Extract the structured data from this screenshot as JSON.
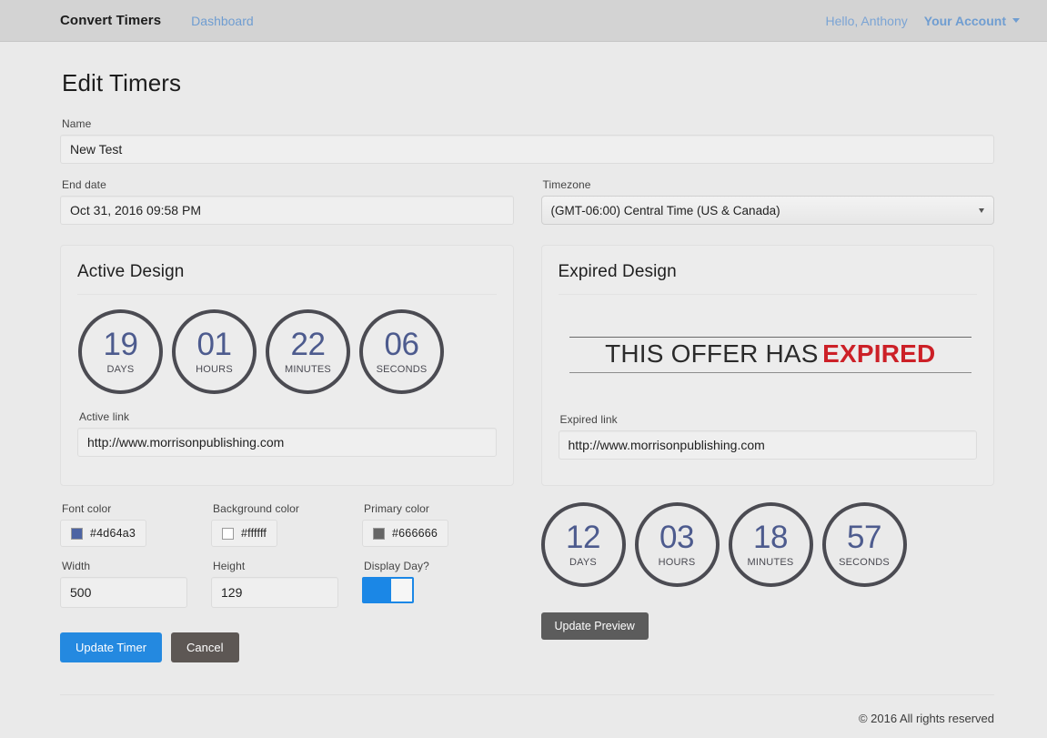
{
  "navbar": {
    "brand": "Convert Timers",
    "dashboard_label": "Dashboard",
    "greeting": "Hello, Anthony",
    "account_label": "Your Account"
  },
  "page": {
    "title": "Edit Timers"
  },
  "form": {
    "name_label": "Name",
    "name_value": "New Test",
    "name_placeholder": "Name",
    "end_date_label": "End date",
    "end_date_value": "Oct 31, 2016 09:58 PM",
    "end_date_placeholder": "End date",
    "timezone_label": "Timezone",
    "timezone_value": "(GMT-06:00) Central Time (US & Canada)"
  },
  "active_design": {
    "title": "Active Design",
    "link_label": "Active link",
    "link_value": "http://www.morrisonpublishing.com",
    "link_placeholder": "Active link",
    "countdown": [
      {
        "value": "19",
        "label": "DAYS"
      },
      {
        "value": "01",
        "label": "HOURS"
      },
      {
        "value": "22",
        "label": "MINUTES"
      },
      {
        "value": "06",
        "label": "SECONDS"
      }
    ]
  },
  "expired_design": {
    "title": "Expired Design",
    "banner_text": "THIS OFFER HAS",
    "banner_word": "EXPIRED",
    "link_label": "Expired link",
    "link_value": "http://www.morrisonpublishing.com",
    "link_placeholder": "Expired link"
  },
  "preview_countdown": [
    {
      "value": "12",
      "label": "DAYS"
    },
    {
      "value": "03",
      "label": "HOURS"
    },
    {
      "value": "18",
      "label": "MINUTES"
    },
    {
      "value": "57",
      "label": "SECONDS"
    }
  ],
  "settings": {
    "font_color_label": "Font color",
    "font_color_value": "#4d64a3",
    "background_color_label": "Background color",
    "background_color_value": "#ffffff",
    "primary_color_label": "Primary color",
    "primary_color_value": "#666666",
    "width_label": "Width",
    "width_value": "500",
    "height_label": "Height",
    "height_value": "129",
    "display_day_label": "Display Day?"
  },
  "buttons": {
    "update_timer": "Update Timer",
    "cancel": "Cancel",
    "update_preview": "Update Preview"
  },
  "footer": {
    "copyright": "© 2016 All rights reserved"
  },
  "colors": {
    "accent_blue": "#2489e0",
    "link_blue": "#6f9dd1",
    "expired_red": "#cc2027",
    "digit_blue": "#4d5b8e"
  }
}
